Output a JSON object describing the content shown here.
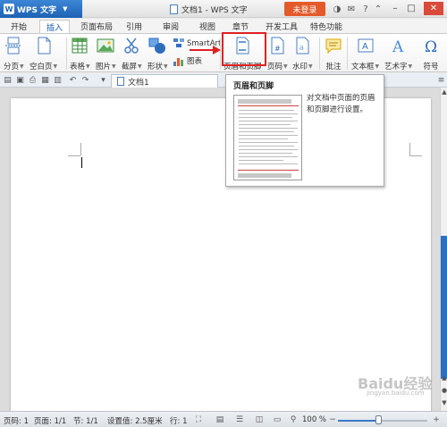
{
  "titlebar": {
    "app_name": "WPS 文字",
    "doc_title": "文档1 - WPS 文字",
    "login_label": "未登录"
  },
  "tabs": [
    {
      "label": "开始"
    },
    {
      "label": "插入"
    },
    {
      "label": "页面布局"
    },
    {
      "label": "引用"
    },
    {
      "label": "审阅"
    },
    {
      "label": "视图"
    },
    {
      "label": "章节"
    },
    {
      "label": "开发工具"
    },
    {
      "label": "特色功能"
    }
  ],
  "ribbon": {
    "page_break": "分页",
    "blank_page": "空白页",
    "table": "表格",
    "picture": "图片",
    "screenshot": "截屏",
    "shapes": "形状",
    "smartart": "SmartArt",
    "chart": "图表",
    "header_footer": "页眉和页脚",
    "page_number": "页码",
    "watermark": "水印",
    "comment": "批注",
    "textbox": "文本框",
    "wordart": "艺术字",
    "symbol": "符号"
  },
  "doc_tabs": {
    "active": "文档1"
  },
  "tooltip": {
    "title": "页眉和页脚",
    "description": "对文档中页面的页眉和页脚进行设置。"
  },
  "statusbar": {
    "page_num": "页码: 1",
    "pages": "页面: 1/1",
    "section": "节: 1/1",
    "setting": "设置值: 2.5厘米",
    "line": "行: 1",
    "zoom": "100 %",
    "zoom_level": 0.45
  },
  "watermark": {
    "text": "Baidu经验",
    "sub": "jingyan.baidu.com"
  }
}
